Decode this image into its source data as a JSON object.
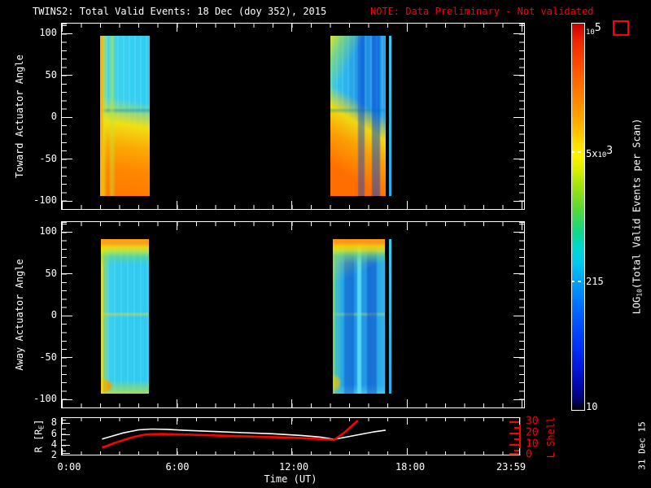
{
  "title": {
    "main": "TWINS2: Total Valid Events: 18 Dec (doy 352), 2015",
    "note": "NOTE: Data Preliminary - Not validated"
  },
  "colors": {
    "background": "#000000",
    "foreground": "#ffffff",
    "alert_red": "#ff0000",
    "r_line": "#ffffff",
    "l_shell_line": "#ff0000"
  },
  "axes": {
    "time": {
      "label": "Time (UT)",
      "ticks": [
        "0:00",
        "6:00",
        "12:00",
        "18:00",
        "23:59"
      ]
    },
    "toward": {
      "title": "Toward Actuator Angle",
      "ticks": [
        "100",
        "50",
        "0",
        "-50",
        "-100"
      ]
    },
    "away": {
      "title": "Away Actuator Angle",
      "ticks": [
        "100",
        "50",
        "0",
        "-50",
        "-100"
      ]
    },
    "r": {
      "title_pre": "R [R",
      "title_sub": "E",
      "title_post": "]",
      "ticks": [
        "8",
        "6",
        "4",
        "2"
      ]
    },
    "l": {
      "title": "L Shell",
      "ticks": [
        "30",
        "20",
        "10",
        "0"
      ]
    },
    "colorbar": {
      "title_pre": "LOG",
      "title_sub": "10",
      "title_post": "(Total Valid Events per Scan)",
      "ticks": [
        {
          "pre": "",
          "base": "10",
          "sup": "5"
        },
        {
          "pre": "5x",
          "base": "10",
          "sup": "3"
        },
        {
          "pre": "215",
          "base": "",
          "sup": ""
        },
        {
          "pre": "10",
          "base": "",
          "sup": ""
        }
      ]
    }
  },
  "footer": {
    "date_stamp": "31 Dec 15"
  },
  "chart_data": [
    {
      "type": "heatmap",
      "panel": "toward",
      "ylabel": "Toward Actuator Angle",
      "xlabel": "Time (UT)",
      "xlim_hours": [
        0,
        24
      ],
      "x_tick_labels": [
        "0:00",
        "6:00",
        "12:00",
        "18:00",
        "23:59"
      ],
      "ylim_deg": [
        -112,
        112
      ],
      "y_tick_values": [
        100,
        50,
        0,
        -50,
        -100
      ],
      "color_scale": {
        "type": "log10",
        "min": 10,
        "max": 100000,
        "label": "LOG10(Total Valid Events per Scan)",
        "tick_labels": [
          "10^5",
          "5x10^3",
          "215",
          "10"
        ]
      },
      "data_segments": [
        {
          "t_start_h": 2.0,
          "t_end_h": 4.6,
          "angle_min_deg": -93,
          "angle_max_deg": 95,
          "profile": "cyan (~10^2-10^3 counts) above ~-10 deg with orange-yellow stripe on leading edge and faint seam near 0 deg; grades through yellow to deep orange (~10^4+) toward -90 deg"
        },
        {
          "t_start_h": 14.0,
          "t_end_h": 16.9,
          "angle_min_deg": -93,
          "angle_max_deg": 95,
          "profile": "yellow-green patch near +90 at segment start; blue body with dark-blue vertical streaks at later times; broad yellow-orange region below ~-20 deg strengthening to deep orange near -90"
        },
        {
          "t_start_h": 17.05,
          "t_end_h": 17.2,
          "angle_min_deg": -93,
          "angle_max_deg": 95,
          "profile": "isolated narrow cyan column"
        }
      ]
    },
    {
      "type": "heatmap",
      "panel": "away",
      "ylabel": "Away Actuator Angle",
      "xlabel": "Time (UT)",
      "xlim_hours": [
        0,
        24
      ],
      "x_tick_labels": [
        "0:00",
        "6:00",
        "12:00",
        "18:00",
        "23:59"
      ],
      "ylim_deg": [
        -112,
        112
      ],
      "y_tick_values": [
        100,
        50,
        0,
        -50,
        -100
      ],
      "color_scale": {
        "type": "log10",
        "min": 10,
        "max": 100000,
        "label": "LOG10(Total Valid Events per Scan)",
        "tick_labels": [
          "10^5",
          "5x10^3",
          "215",
          "10"
        ]
      },
      "data_segments": [
        {
          "t_start_h": 2.05,
          "t_end_h": 4.55,
          "angle_min_deg": -93,
          "angle_max_deg": 95,
          "profile": "orange-to-yellow band at +90..+70; cyan body with vertical striping; faint warm line near 0 deg; small orange spot near -90 at segment start; green-yellow bottom edge"
        },
        {
          "t_start_h": 14.15,
          "t_end_h": 16.85,
          "angle_min_deg": -93,
          "angle_max_deg": 95,
          "profile": "orange/yellow band at top; deeper blue body with bright cyan and dark-blue vertical streaks; warm yellow-orange spot near -90 at segment start; cyan bottom edge"
        },
        {
          "t_start_h": 17.08,
          "t_end_h": 17.2,
          "angle_min_deg": -93,
          "angle_max_deg": 95,
          "profile": "isolated narrow cyan column"
        }
      ]
    },
    {
      "type": "line",
      "panel": "ephemeris",
      "xlabel": "Time (UT)",
      "xlim_hours": [
        0,
        24
      ],
      "left_axis": {
        "label": "R [RE]",
        "ticks": [
          2,
          4,
          6,
          8
        ],
        "color": "#ffffff"
      },
      "right_axis": {
        "label": "L Shell",
        "ticks": [
          0,
          10,
          20,
          30
        ],
        "color": "#ff0000"
      },
      "series": [
        {
          "name": "R [RE]",
          "axis": "left",
          "color": "#ffffff",
          "points": [
            [
              2.1,
              5.1
            ],
            [
              2.6,
              5.6
            ],
            [
              3.2,
              6.2
            ],
            [
              4.0,
              6.75
            ],
            [
              4.7,
              6.9
            ],
            [
              5.5,
              6.85
            ],
            [
              6.5,
              6.65
            ],
            [
              8.0,
              6.45
            ],
            [
              9.5,
              6.25
            ],
            [
              11.0,
              6.05
            ],
            [
              12.5,
              5.75
            ],
            [
              13.5,
              5.45
            ],
            [
              14.2,
              5.05
            ],
            [
              14.9,
              5.5
            ],
            [
              15.6,
              5.95
            ],
            [
              16.3,
              6.4
            ],
            [
              16.9,
              6.7
            ]
          ]
        },
        {
          "name": "L Shell",
          "axis": "right",
          "color": "#ff0000",
          "points": [
            [
              2.1,
              7.0
            ],
            [
              2.8,
              11.5
            ],
            [
              3.6,
              16.0
            ],
            [
              4.4,
              19.0
            ],
            [
              5.2,
              19.3
            ],
            [
              6.5,
              18.8
            ],
            [
              8.0,
              18.0
            ],
            [
              10.0,
              17.0
            ],
            [
              12.0,
              16.0
            ],
            [
              13.3,
              15.0
            ],
            [
              14.2,
              14.0
            ],
            [
              14.7,
              20.0
            ],
            [
              15.1,
              26.0
            ],
            [
              15.45,
              31.5
            ]
          ]
        }
      ]
    }
  ]
}
